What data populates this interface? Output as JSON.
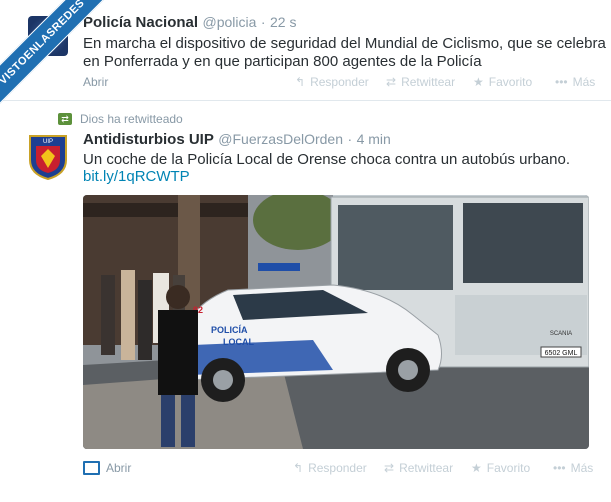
{
  "watermark": "VISTOENLASREDES",
  "tweet1": {
    "name": "Policía Nacional",
    "handle": "@policia",
    "separator": "·",
    "time": "22 s",
    "text_line1": "En marcha el dispositivo de seguridad del Mundial de Ciclismo, que se celebra",
    "text_line2": "en Ponferrada y en que participan 800 agentes de la Policía",
    "expand": "Abrir",
    "actions": {
      "reply": "Responder",
      "retweet": "Retwittear",
      "favorite": "Favorito",
      "more": "Más"
    }
  },
  "tweet2": {
    "retweet_context": "Dios ha retwitteado",
    "name": "Antidisturbios UIP",
    "handle": "@FuerzasDelOrden",
    "separator": "·",
    "time": "4 min",
    "text": "Un coche de la Policía Local de Orense choca contra un autobús urbano.",
    "link": "bit.ly/1qRCWTP",
    "avatar_text": "UIP",
    "photo": {
      "car_side_text_1": "POLICÍA",
      "car_side_text_2": "LOCAL",
      "car_number": "92",
      "bus_plate": "6502 GML",
      "bus_brand": "SCANIA"
    },
    "expand": "Abrir",
    "actions": {
      "reply": "Responder",
      "retweet": "Retwittear",
      "favorite": "Favorito",
      "more": "Más"
    }
  },
  "colors": {
    "link": "#0084b4",
    "muted": "#8899a6",
    "action": "#c4cfd6",
    "retweet_green": "#5c913b",
    "banner": "#1f6fb2"
  }
}
